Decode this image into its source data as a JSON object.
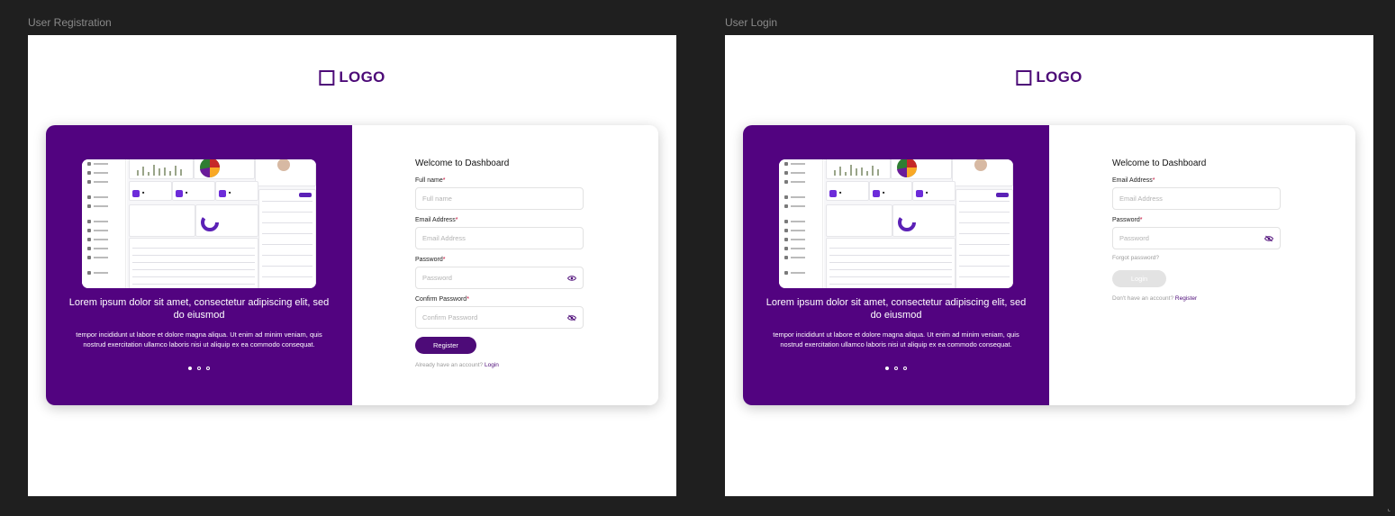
{
  "frames": [
    {
      "label": "User Registration",
      "logo_text": "LOGO",
      "promo": {
        "title": "Lorem ipsum dolor sit amet, consectetur adipiscing elit, sed do eiusmod",
        "body": "tempor incididunt ut labore et dolore magna aliqua. Ut enim ad minim veniam, quis nostrud exercitation ullamco laboris nisi ut aliquip ex ea commodo consequat.",
        "active_dot": 1
      },
      "form": {
        "title": "Welcome to Dashboard",
        "fields": [
          {
            "label": "Full name",
            "placeholder": "Full name"
          },
          {
            "label": "Email Address",
            "placeholder": "Email Address"
          },
          {
            "label": "Password",
            "placeholder": "Password",
            "icon": "eye-icon"
          },
          {
            "label": "Confirm Password",
            "placeholder": "Confirm Password",
            "icon": "eye-off-icon"
          }
        ],
        "required_mark": "*",
        "submit_label": "Register",
        "footnote_text": "Already have an account?",
        "footnote_link": "Login"
      }
    },
    {
      "label": "User Login",
      "logo_text": "LOGO",
      "promo": {
        "title": "Lorem ipsum dolor sit amet, consectetur adipiscing elit, sed do eiusmod",
        "body": "tempor incididunt ut labore et dolore magna aliqua. Ut enim ad minim veniam, quis nostrud exercitation ullamco laboris nisi ut aliquip ex ea commodo consequat.",
        "active_dot": 1
      },
      "form": {
        "title": "Welcome to Dashboard",
        "fields": [
          {
            "label": "Email Address",
            "placeholder": "Email Address"
          },
          {
            "label": "Password",
            "placeholder": "Password",
            "icon": "eye-off-icon"
          }
        ],
        "required_mark": "*",
        "forgot_label": "Forgot password?",
        "submit_label": "Login",
        "footnote_text": "Don't have an account?",
        "footnote_link": "Register"
      }
    }
  ],
  "colors": {
    "brand": "#4d0b78",
    "panel": "#520380",
    "required": "#c2002f",
    "disabled_button": "#e3e3e3"
  }
}
